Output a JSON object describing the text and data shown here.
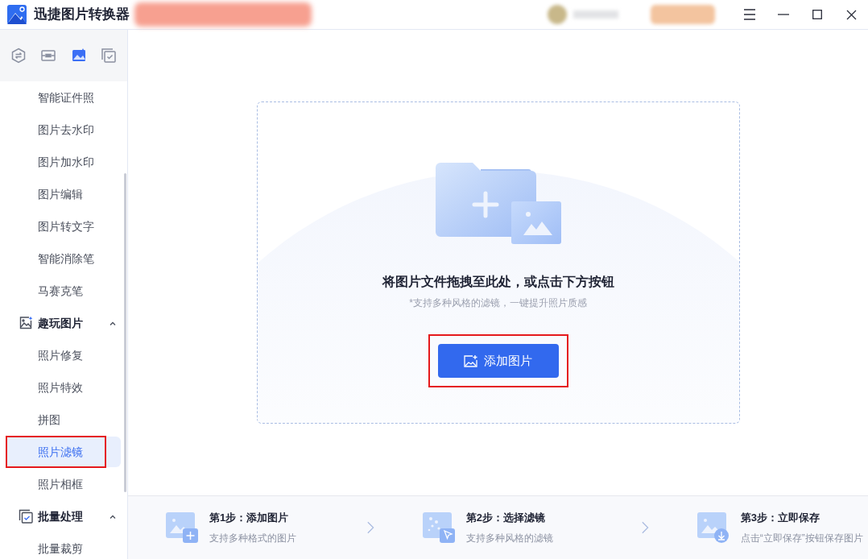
{
  "window": {
    "title": "迅捷图片转换器"
  },
  "sidebar": {
    "tool_tabs": [
      {
        "selected": false
      },
      {
        "selected": false
      },
      {
        "selected": true
      },
      {
        "selected": false
      }
    ],
    "items": [
      {
        "kind": "item",
        "label": "智能证件照",
        "selected": false
      },
      {
        "kind": "item",
        "label": "图片去水印",
        "selected": false
      },
      {
        "kind": "item",
        "label": "图片加水印",
        "selected": false
      },
      {
        "kind": "item",
        "label": "图片编辑",
        "selected": false
      },
      {
        "kind": "item",
        "label": "图片转文字",
        "selected": false
      },
      {
        "kind": "item",
        "label": "智能消除笔",
        "selected": false
      },
      {
        "kind": "item",
        "label": "马赛克笔",
        "selected": false
      },
      {
        "kind": "section",
        "label": "趣玩图片",
        "expanded": true,
        "children": [
          {
            "label": "照片修复",
            "selected": false
          },
          {
            "label": "照片特效",
            "selected": false
          },
          {
            "label": "拼图",
            "selected": false
          },
          {
            "label": "照片滤镜",
            "selected": true,
            "highlighted": true
          },
          {
            "label": "照片相框",
            "selected": false
          }
        ]
      },
      {
        "kind": "section",
        "label": "批量处理",
        "expanded": true,
        "children": [
          {
            "label": "批量裁剪",
            "selected": false
          }
        ]
      }
    ]
  },
  "dropzone": {
    "heading": "将图片文件拖拽至此处，或点击下方按钮",
    "hint": "*支持多种风格的滤镜，一键提升照片质感",
    "button": {
      "label": "添加图片",
      "highlighted": true
    }
  },
  "steps": [
    {
      "title": "第1步：添加图片",
      "subtitle": "支持多种格式的图片"
    },
    {
      "title": "第2步：选择滤镜",
      "subtitle": "支持多种风格的滤镜"
    },
    {
      "title": "第3步：立即保存",
      "subtitle": "点击“立即保存”按钮保存图片"
    }
  ]
}
